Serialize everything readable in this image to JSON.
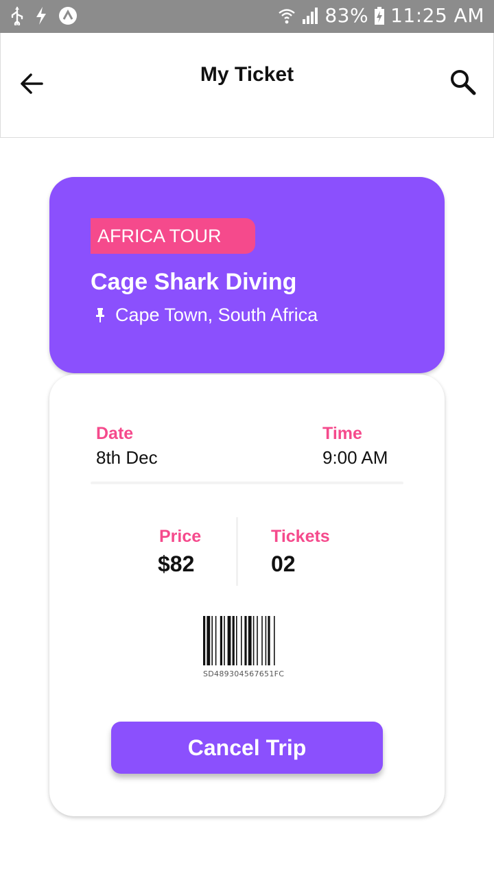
{
  "status_bar": {
    "battery_percent": "83%",
    "time": "11:25 AM",
    "left_icons": [
      "usb-icon",
      "flash-icon",
      "android-icon"
    ],
    "right_icons": [
      "wifi-icon",
      "signal-icon",
      "battery-charging-icon"
    ]
  },
  "header": {
    "title": "My Ticket",
    "back_icon": "arrow-left-icon",
    "search_icon": "search-icon"
  },
  "event": {
    "tag": "AFRICA TOUR",
    "title": "Cage Shark Diving",
    "location": "Cape Town, South Africa",
    "location_icon": "pin-icon",
    "accent_color": "#8b50fd",
    "tag_color": "#f54a8c"
  },
  "details": {
    "date_label": "Date",
    "date_value": "8th Dec",
    "time_label": "Time",
    "time_value": "9:00 AM",
    "price_label": "Price",
    "price_value": "$82",
    "tickets_label": "Tickets",
    "tickets_value": "02",
    "barcode_text": "SD489304567651FC"
  },
  "actions": {
    "cancel_label": "Cancel Trip"
  }
}
